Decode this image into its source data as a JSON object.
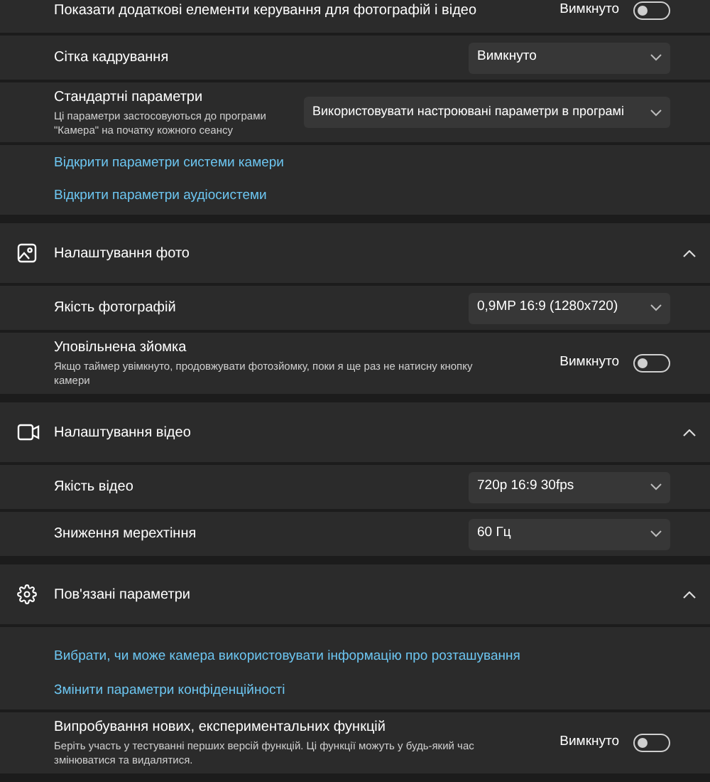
{
  "sections": [
    {
      "rows": [
        {
          "kind": "toggle",
          "title": "Показати додаткові елементи керування для фотографій і відео",
          "state_label": "Вимкнуто",
          "on": false
        },
        {
          "kind": "dropdown",
          "title": "Сітка кадрування",
          "value": "Вимкнуто"
        },
        {
          "kind": "dropdown",
          "title": "Стандартні параметри",
          "description": "Ці параметри застосовуються до програми \"Камера\" на початку кожного сеансу",
          "value": "Використовувати настроювані параметри в програмі",
          "wide": true
        },
        {
          "kind": "links",
          "links": [
            "Відкрити параметри системи камери",
            "Відкрити параметри аудіосистеми"
          ]
        }
      ]
    },
    {
      "header": {
        "title": "Налаштування фото",
        "kind": "photo",
        "expanded": true
      },
      "rows": [
        {
          "kind": "dropdown",
          "title": "Якість фотографій",
          "value": "0,9MP 16:9 (1280x720)"
        },
        {
          "kind": "toggle",
          "title": "Уповільнена зйомка",
          "description": "Якщо таймер увімкнуто, продовжувати фотозйомку, поки я ще раз не натисну кнопку камери",
          "state_label": "Вимкнуто",
          "on": false
        }
      ]
    },
    {
      "header": {
        "title": "Налаштування відео",
        "kind": "video",
        "expanded": true
      },
      "rows": [
        {
          "kind": "dropdown",
          "title": "Якість відео",
          "value": "720p 16:9 30fps"
        },
        {
          "kind": "dropdown",
          "title": "Зниження мерехтіння",
          "value": "60 Гц"
        }
      ]
    },
    {
      "header": {
        "title": "Пов'язані параметри",
        "kind": "gear",
        "expanded": true
      },
      "rows": [
        {
          "kind": "links",
          "links": [
            "Вибрати, чи може камера використовувати інформацію про розташування",
            "Змінити параметри конфіденційності"
          ]
        },
        {
          "kind": "toggle",
          "title": "Випробування нових, експериментальних функцій",
          "description": "Беріть участь у тестуванні перших версій функцій. Ці функції можуть у будь-який час змінюватися та видалятися.",
          "state_label": "Вимкнуто",
          "on": false
        }
      ]
    }
  ]
}
